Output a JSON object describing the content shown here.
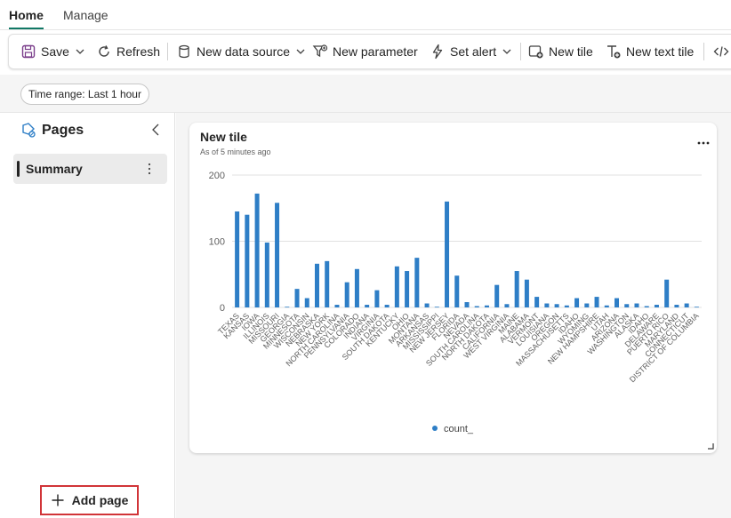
{
  "tabs": {
    "home": "Home",
    "manage": "Manage"
  },
  "toolbar": {
    "save": "Save",
    "refresh": "Refresh",
    "new_data_source": "New data source",
    "new_parameter": "New parameter",
    "set_alert": "Set alert",
    "new_tile": "New tile",
    "new_text_tile": "New text tile"
  },
  "filter": {
    "time_range": "Time range: Last 1 hour"
  },
  "sidebar": {
    "title": "Pages",
    "pages": [
      {
        "label": "Summary"
      }
    ],
    "add_page": "Add page"
  },
  "tile": {
    "title": "New tile",
    "subtitle": "As of 5 minutes ago"
  },
  "colors": {
    "accent": "#117865",
    "series": "#2e7ec6",
    "highlight_border": "#d13438"
  },
  "chart_data": {
    "type": "bar",
    "ylim": [
      0,
      200
    ],
    "yticks": [
      0,
      100,
      200
    ],
    "legend": "bottom-center",
    "categories": [
      "TEXAS",
      "KANSAS",
      "IOWA",
      "ILLINOIS",
      "MISSOURI",
      "GEORGIA",
      "MINNESOTA",
      "WISCONSIN",
      "NEBRASKA",
      "NEW YORK",
      "NORTH CAROLINA",
      "PENNSYLVANIA",
      "COLORADO",
      "INDIANA",
      "VIRGINIA",
      "SOUTH DAKOTA",
      "KENTUCKY",
      "OHIO",
      "MONTANA",
      "ARKANSAS",
      "MISSISSIPPI",
      "NEW JERSEY",
      "FLORIDA",
      "NEVADA",
      "SOUTH CAROLINA",
      "NORTH DAKOTA",
      "CALIFORNIA",
      "WEST VIRGINIA",
      "MAINE",
      "ALABAMA",
      "VERMONT",
      "LOUISIANA",
      "OREGON",
      "MASSACHUSETTS",
      "IDAHO",
      "WYOMING",
      "NEW HAMPSHIRE",
      "UTAH",
      "ARIZONA",
      "WASHINGTON",
      "ALASKA",
      "IDAHO",
      "DELAWARE",
      "PUERTO RICO",
      "MARYLAND",
      "CONNECTICUT",
      "DISTRICT OF COLUMBIA"
    ],
    "label_every": 1,
    "series": [
      {
        "name": "count_",
        "values": [
          145,
          140,
          172,
          98,
          158,
          1,
          28,
          14,
          66,
          70,
          4,
          38,
          58,
          4,
          26,
          4,
          62,
          55,
          75,
          6,
          1,
          160,
          48,
          8,
          2,
          3,
          34,
          5,
          55,
          42,
          16,
          6,
          5,
          3,
          14,
          6,
          16,
          3,
          14,
          5,
          6,
          2,
          4,
          42,
          4,
          6,
          1
        ]
      }
    ]
  }
}
